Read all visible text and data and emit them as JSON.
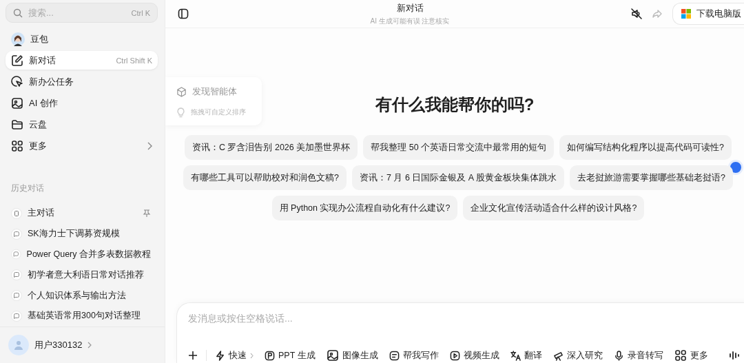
{
  "sidebar": {
    "search": {
      "placeholder": "搜索...",
      "shortcut": "Ctrl K"
    },
    "nav": [
      {
        "label": "豆包",
        "expandable": false,
        "selected": false
      },
      {
        "label": "新对话",
        "shortcut": "Ctrl Shift K",
        "expandable": false,
        "selected": true
      },
      {
        "label": "新办公任务",
        "expandable": false,
        "selected": false
      },
      {
        "label": "AI 创作",
        "expandable": false,
        "selected": false
      },
      {
        "label": "云盘",
        "expandable": false,
        "selected": false
      },
      {
        "label": "更多",
        "expandable": true,
        "selected": false
      }
    ],
    "history_heading": "历史对话",
    "history": [
      {
        "title": "主对话",
        "kind": "main",
        "pinned": true
      },
      {
        "title": "SK海力士下调募资规模",
        "kind": "chat",
        "pinned": false
      },
      {
        "title": "Power Query 合并多表数据教程",
        "kind": "chat",
        "pinned": false
      },
      {
        "title": "初学者意大利语日常对话推荐",
        "kind": "chat",
        "pinned": false
      },
      {
        "title": "个人知识体系与输出方法",
        "kind": "chat",
        "pinned": false
      },
      {
        "title": "基础英语常用300句对话整理",
        "kind": "chat",
        "pinned": false
      }
    ],
    "user": {
      "name": "用户330132"
    }
  },
  "popup": {
    "items": [
      {
        "label": "发现智能体",
        "kind": "item"
      },
      {
        "label": "拖拽可自定义排序",
        "kind": "hint"
      }
    ]
  },
  "header": {
    "title": "新对话",
    "subtitle": "AI 生成可能有误 注意核实",
    "download": "下载电脑版"
  },
  "home": {
    "heading": "有什么我能帮你的吗?",
    "suggestions": [
      [
        "资讯：C 罗含泪告别 2026 美加墨世界杯",
        "帮我整理 50 个英语日常交流中最常用的短句",
        "如何编写结构化程序以提高代码可读性?"
      ],
      [
        "有哪些工具可以帮助校对和润色文稿?",
        "资讯：7 月 6 日国际金银及 A 股黄金板块集体跳水",
        "去老挝旅游需要掌握哪些基础老挝语?"
      ],
      [
        "用 Python 实现办公流程自动化有什么建议?",
        "企业文化宣传活动适合什么样的设计风格?"
      ]
    ]
  },
  "composer": {
    "placeholder": "发消息或按住空格说话...",
    "tools": [
      {
        "label": "快速",
        "dropdown": true
      },
      {
        "label": "PPT 生成",
        "dropdown": false
      },
      {
        "label": "图像生成",
        "dropdown": false
      },
      {
        "label": "帮我写作",
        "dropdown": false
      },
      {
        "label": "视频生成",
        "dropdown": false
      },
      {
        "label": "翻译",
        "dropdown": false
      },
      {
        "label": "深入研究",
        "dropdown": false
      },
      {
        "label": "录音转写",
        "dropdown": false
      },
      {
        "label": "更多",
        "dropdown": false
      }
    ]
  }
}
